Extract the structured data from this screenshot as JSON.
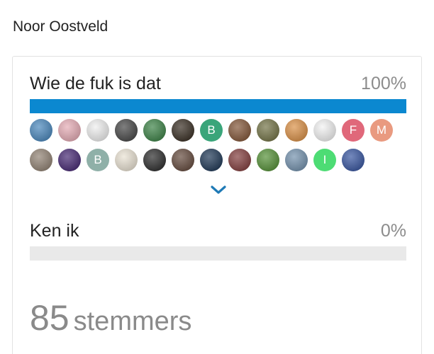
{
  "post": {
    "author": "Noor Oostveld"
  },
  "poll": {
    "accent": "#0b88d0",
    "options": [
      {
        "label": "Wie de fuk is dat",
        "percent_text": "100%",
        "fraction": 1.0
      },
      {
        "label": "Ken ik",
        "percent_text": "0%",
        "fraction": 0.0
      }
    ],
    "voters_row1": [
      {
        "initial": "",
        "icon": "blue-photo-avatar",
        "color": "#3d7fb8"
      },
      {
        "initial": "",
        "icon": "pink-pattern-avatar",
        "color": "#e4a6b0"
      },
      {
        "initial": "",
        "icon": "cherub-avatar",
        "color": "#eeeeee"
      },
      {
        "initial": "",
        "icon": "black-cat-avatar",
        "color": "#3a3a3a"
      },
      {
        "initial": "",
        "icon": "green-nature-avatar",
        "color": "#2f7a3a"
      },
      {
        "initial": "",
        "icon": "egyptian-statue-avatar",
        "color": "#2b2014"
      },
      {
        "initial": "B",
        "icon": "",
        "color": "#3aa57a"
      },
      {
        "initial": "",
        "icon": "group-photo-avatar",
        "color": "#7a4a2a"
      },
      {
        "initial": "",
        "icon": "person-photo-avatar",
        "color": "#6a6a3a"
      },
      {
        "initial": "",
        "icon": "food-photo-avatar",
        "color": "#d8893a"
      },
      {
        "initial": "",
        "icon": "sketch-avatar",
        "color": "#f2f2f2"
      },
      {
        "initial": "F",
        "icon": "",
        "color": "#e0687a"
      },
      {
        "initial": "M",
        "icon": "",
        "color": "#e99a80"
      }
    ],
    "voters_row2": [
      {
        "initial": "",
        "icon": "dog-photo-avatar",
        "color": "#8a7a6a"
      },
      {
        "initial": "",
        "icon": "purple-neon-avatar",
        "color": "#3a1a6a"
      },
      {
        "initial": "B",
        "icon": "",
        "color": "#8fb0a8"
      },
      {
        "initial": "",
        "icon": "drawing-avatar",
        "color": "#e8e0d0"
      },
      {
        "initial": "",
        "icon": "bw-portrait-avatar",
        "color": "#1e1e1e"
      },
      {
        "initial": "",
        "icon": "portrait-avatar",
        "color": "#5a3e30"
      },
      {
        "initial": "",
        "icon": "moon-logo-avatar",
        "color": "#0f2a4a"
      },
      {
        "initial": "",
        "icon": "deck-chair-avatar",
        "color": "#7a3030"
      },
      {
        "initial": "",
        "icon": "green-leaves-avatar",
        "color": "#4a8a2a"
      },
      {
        "initial": "",
        "icon": "pelican-avatar",
        "color": "#6a8aa8"
      },
      {
        "initial": "I",
        "icon": "",
        "color": "#4ddc74"
      },
      {
        "initial": "",
        "icon": "blue-pattern-avatar",
        "color": "#2a4a9a"
      }
    ],
    "voters_count": "85",
    "voters_word": "stemmers"
  }
}
